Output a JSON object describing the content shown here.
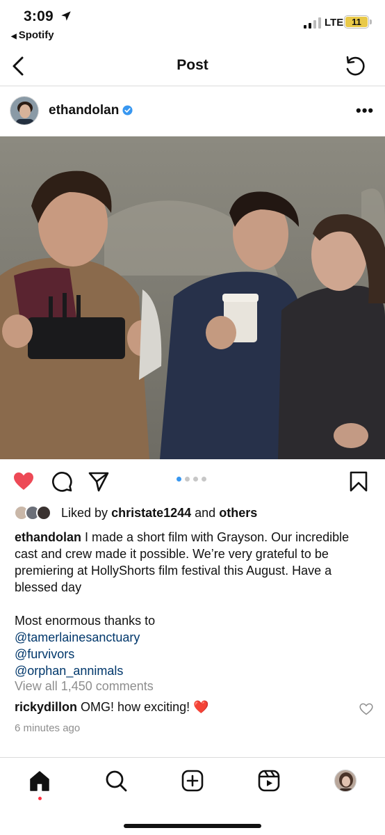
{
  "status_bar": {
    "time": "3:09",
    "back_app": "Spotify",
    "network": "LTE",
    "battery": "11",
    "icons": [
      "location-arrow-icon",
      "signal-icon",
      "battery-icon"
    ]
  },
  "nav": {
    "title": "Post",
    "icons": [
      "chevron-left-icon",
      "refresh-icon"
    ]
  },
  "post": {
    "username": "ethandolan",
    "verified": true,
    "more_label": "•••",
    "carousel": {
      "count": 4,
      "active_index": 0
    },
    "liked_by_prefix": "Liked by",
    "liked_by_user": "christate1244",
    "liked_by_and": "and",
    "liked_by_others": "others",
    "caption": {
      "username": "ethandolan",
      "text": "I made a short film with Grayson. Our incredible cast and crew made it possible. We’re very grateful to be premiering at HollyShorts film festival this August. Have a blessed day",
      "thanks": "Most enormous thanks to",
      "mentions": [
        "@tamerlainesanctuary",
        "@furvivors",
        "@orphan_annimals"
      ]
    },
    "view_comments": "View all 1,450 comments",
    "comment": {
      "username": "rickydillon",
      "text": "OMG! how exciting!",
      "emoji": "❤️"
    },
    "timestamp": "6 minutes ago",
    "liked": true
  },
  "colors": {
    "like_red": "#ed4956",
    "link_blue": "#00376b",
    "verified_blue": "#3897f0",
    "muted_gray": "#8e8e8e",
    "battery_yellow": "#e9c948"
  },
  "tab_bar": {
    "items": [
      "home-icon",
      "search-icon",
      "create-icon",
      "reels-icon",
      "profile-avatar"
    ],
    "active": "home"
  }
}
